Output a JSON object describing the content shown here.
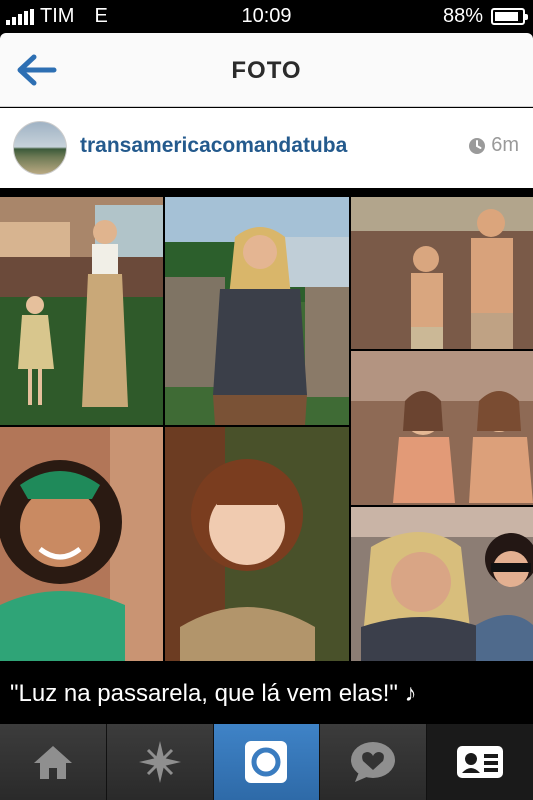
{
  "status_bar": {
    "carrier": "TIM",
    "network": "E",
    "time": "10:09",
    "battery": "88%",
    "battery_level": 0.88
  },
  "nav": {
    "title": "FOTO",
    "back_icon": "back-arrow-icon"
  },
  "post": {
    "username": "transamericacomandatuba",
    "time_ago": "6m",
    "caption": "\"Luz na passarela, que lá vem elas!\" ♪"
  },
  "tabs": [
    {
      "name": "home",
      "icon": "home-icon"
    },
    {
      "name": "explore",
      "icon": "explore-icon"
    },
    {
      "name": "camera",
      "icon": "camera-icon",
      "active": true
    },
    {
      "name": "news",
      "icon": "news-icon"
    },
    {
      "name": "profile",
      "icon": "profile-icon"
    }
  ],
  "colors": {
    "accent": "#245a8d",
    "active_tab": "#3a7cc0"
  }
}
